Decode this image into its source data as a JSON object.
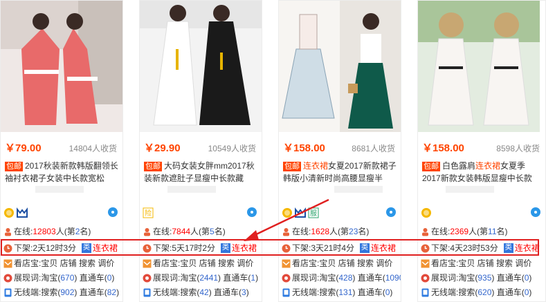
{
  "products": [
    {
      "price": "￥79.00",
      "sales": "14804人收货",
      "badge": "包邮",
      "title_before": "2017秋装新款韩版翻领长袖衬衣裙子女装中长款宽松",
      "title_hl": "",
      "title_after": "",
      "online_prefix": "在线:",
      "online_count": "12803",
      "online_mid": "人(第",
      "online_rank": "2",
      "online_suffix": "名)",
      "offshelf": "下架:2天12时3分",
      "category": "连衣裙",
      "shop_view": "看店宝:宝贝 店铺 搜索 调价",
      "exposure_prefix": "展现词:淘宝(",
      "exposure_taobao": "670",
      "exposure_mid": ") 直通车(",
      "exposure_ztc": "0",
      "exposure_suffix": ")",
      "wireless_prefix": "无线端:搜索(",
      "wireless_search": "902",
      "wireless_mid": ") 直通车(",
      "wireless_ztc": "82",
      "wireless_suffix": ")",
      "shop_icons": [
        "gold-medal-icon",
        "tmall-cat-icon"
      ]
    },
    {
      "price": "￥29.90",
      "sales": "10549人收货",
      "badge": "包邮",
      "title_before": "大码女装女胖mm2017秋装新款遮肚子显瘦中长款藏",
      "title_hl": "",
      "title_after": "",
      "online_prefix": "在线:",
      "online_count": "7844",
      "online_mid": "人(第",
      "online_rank": "5",
      "online_suffix": "名)",
      "offshelf": "下架:5天17时2分",
      "category": "连衣裙",
      "shop_view": "看店宝:宝贝 店铺 搜索 调价",
      "exposure_prefix": "展现词:淘宝(",
      "exposure_taobao": "2441",
      "exposure_mid": ") 直通车(",
      "exposure_ztc": "1",
      "exposure_suffix": ")",
      "wireless_prefix": "无线端:搜索(",
      "wireless_search": "42",
      "wireless_mid": ") 直通车(",
      "wireless_ztc": "3",
      "wireless_suffix": ")",
      "shop_icons": [
        "insured-icon"
      ]
    },
    {
      "price": "￥158.00",
      "sales": "8681人收货",
      "badge": "包邮",
      "title_before": "",
      "title_hl": "连衣裙",
      "title_after": "女夏2017新款裙子韩版小清新时尚高腰显瘦半",
      "online_prefix": "在线:",
      "online_count": "1628",
      "online_mid": "人(第",
      "online_rank": "23",
      "online_suffix": "名)",
      "offshelf": "下架:3天21时4分",
      "category": "连衣裙",
      "shop_view": "看店宝:宝贝 店铺 搜索 调价",
      "exposure_prefix": "展现词:淘宝(",
      "exposure_taobao": "428",
      "exposure_mid": ") 直通车(",
      "exposure_ztc": "1090",
      "exposure_suffix": ")",
      "wireless_prefix": "无线端:搜索(",
      "wireless_search": "131",
      "wireless_mid": ") 直通车(",
      "wireless_ztc": "0",
      "wireless_suffix": ")",
      "shop_icons": [
        "gold-medal-icon",
        "tmall-cat-icon",
        "service-icon"
      ]
    },
    {
      "price": "￥158.00",
      "sales": "8598人收货",
      "badge": "包邮",
      "title_before": "白色露肩",
      "title_hl": "连衣裙",
      "title_after": "女夏季2017新款女装韩版显瘦中长款",
      "online_prefix": "在线:",
      "online_count": "2369",
      "online_mid": "人(第",
      "online_rank": "11",
      "online_suffix": "名)",
      "offshelf": "下架:4天23时53分",
      "category": "连衣裙",
      "shop_view": "看店宝:宝贝 店铺 搜索 调价",
      "exposure_prefix": "展现词:淘宝(",
      "exposure_taobao": "935",
      "exposure_mid": ") 直通车(",
      "exposure_ztc": "0",
      "exposure_suffix": ")",
      "wireless_prefix": "无线端:搜索(",
      "wireless_search": "620",
      "wireless_mid": ") 直通车(",
      "wireless_ztc": "0",
      "wireless_suffix": ")",
      "shop_icons": [
        "gold-medal-icon"
      ]
    }
  ],
  "category_badge": "类",
  "colors": {
    "price": "#ff4400",
    "highlight_box": "#e02020",
    "link_blue": "#3366cc",
    "arrow": "#e02020"
  }
}
